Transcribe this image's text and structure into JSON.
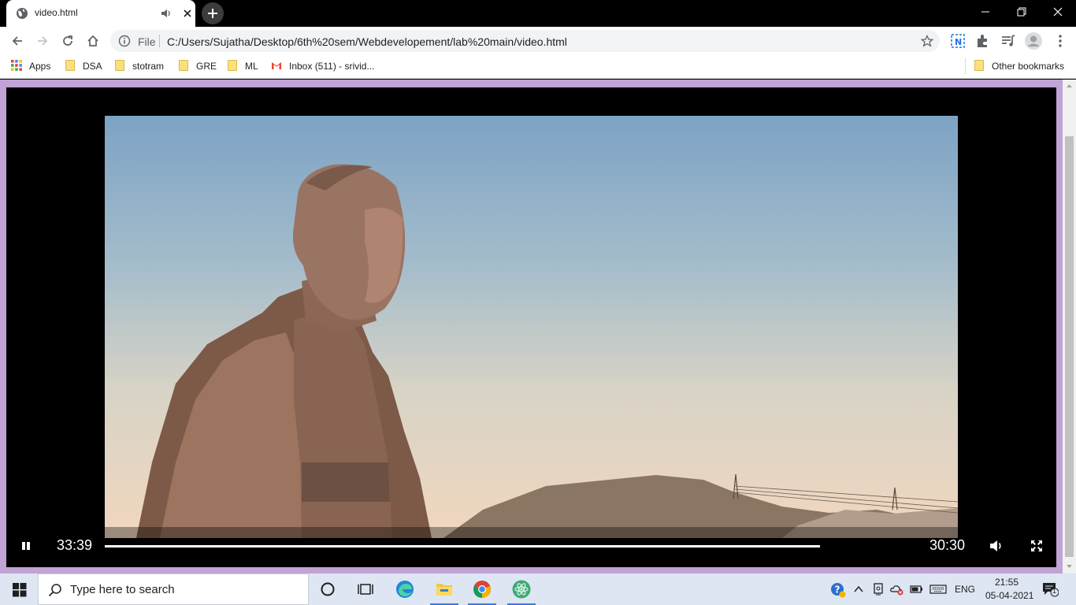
{
  "tab": {
    "title": "video.html"
  },
  "omnibox": {
    "scheme": "File",
    "url": "C:/Users/Sujatha/Desktop/6th%20sem/Webdevelopement/lab%20main/video.html"
  },
  "bookmarks": [
    {
      "label": "Apps",
      "icon": "apps-grid-icon"
    },
    {
      "label": "DSA",
      "icon": "folder-icon"
    },
    {
      "label": "stotram",
      "icon": "folder-icon"
    },
    {
      "label": "GRE",
      "icon": "folder-icon"
    },
    {
      "label": "ML",
      "icon": "folder-icon"
    },
    {
      "label": "Inbox (511) - srivid...",
      "icon": "gmail-icon"
    }
  ],
  "other_bookmarks": "Other bookmarks",
  "video": {
    "current_time": "33:39",
    "duration": "30:30",
    "progress_fraction": 1.0,
    "state": "playing"
  },
  "taskbar": {
    "search_placeholder": "Type here to search",
    "language": "ENG",
    "time": "21:55",
    "date": "05-04-2021",
    "notification_count": "1"
  },
  "colors": {
    "page_background": "#c1a3d6",
    "player_background": "#000000",
    "taskbar": "#dde6f2"
  }
}
